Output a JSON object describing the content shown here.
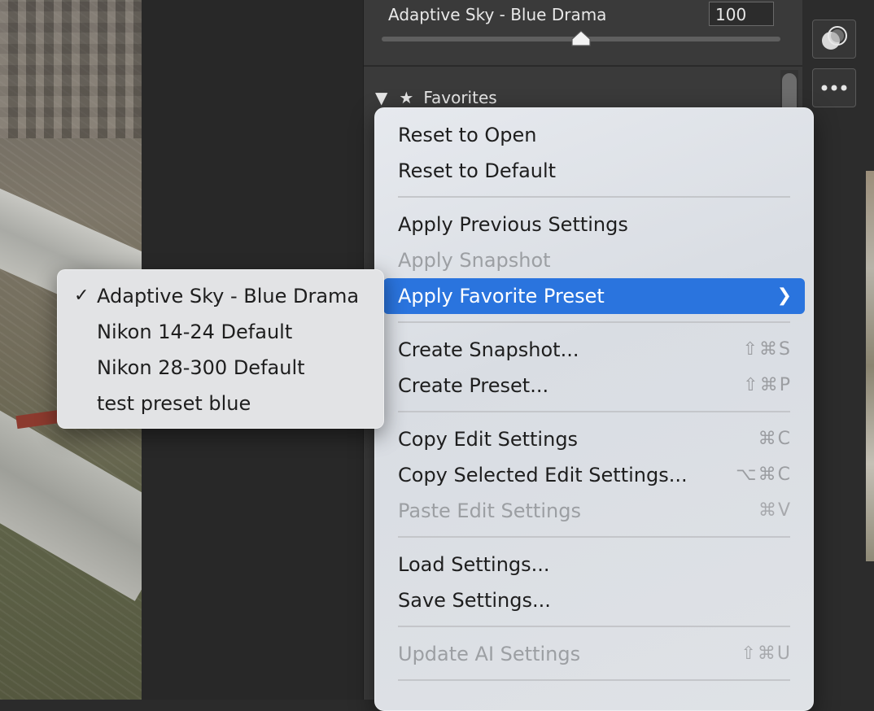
{
  "slider": {
    "label": "Adaptive Sky - Blue Drama",
    "value": "100",
    "level": 0.5
  },
  "favorites": {
    "title": "Favorites",
    "arrow_icon": "disclosure-triangle-down-icon",
    "star_icon": "star-icon"
  },
  "tools": {
    "mask_icon": "mask-icon",
    "more_icon": "more-icon"
  },
  "menu": {
    "reset_open": "Reset to Open",
    "reset_default": "Reset to Default",
    "apply_previous": "Apply Previous Settings",
    "apply_snapshot": "Apply Snapshot",
    "apply_favorite": "Apply Favorite Preset",
    "create_snapshot": "Create Snapshot...",
    "create_snapshot_sc": "⇧⌘S",
    "create_preset": "Create Preset...",
    "create_preset_sc": "⇧⌘P",
    "copy_edit": "Copy Edit Settings",
    "copy_edit_sc": "⌘C",
    "copy_selected": "Copy Selected Edit Settings...",
    "copy_selected_sc": "⌥⌘C",
    "paste_edit": "Paste Edit Settings",
    "paste_edit_sc": "⌘V",
    "load_settings": "Load Settings...",
    "save_settings": "Save Settings...",
    "update_ai": "Update AI Settings",
    "update_ai_sc": "⇧⌘U"
  },
  "submenu": {
    "items": [
      {
        "label": "Adaptive Sky - Blue Drama",
        "checked": true
      },
      {
        "label": "Nikon 14-24 Default",
        "checked": false
      },
      {
        "label": "Nikon 28-300 Default",
        "checked": false
      },
      {
        "label": "test preset blue",
        "checked": false
      }
    ],
    "check_glyph": "✓"
  },
  "colors": {
    "highlight": "#2a74de",
    "panel": "#3a3a3a",
    "menu_bg": "#e2e5ea"
  }
}
